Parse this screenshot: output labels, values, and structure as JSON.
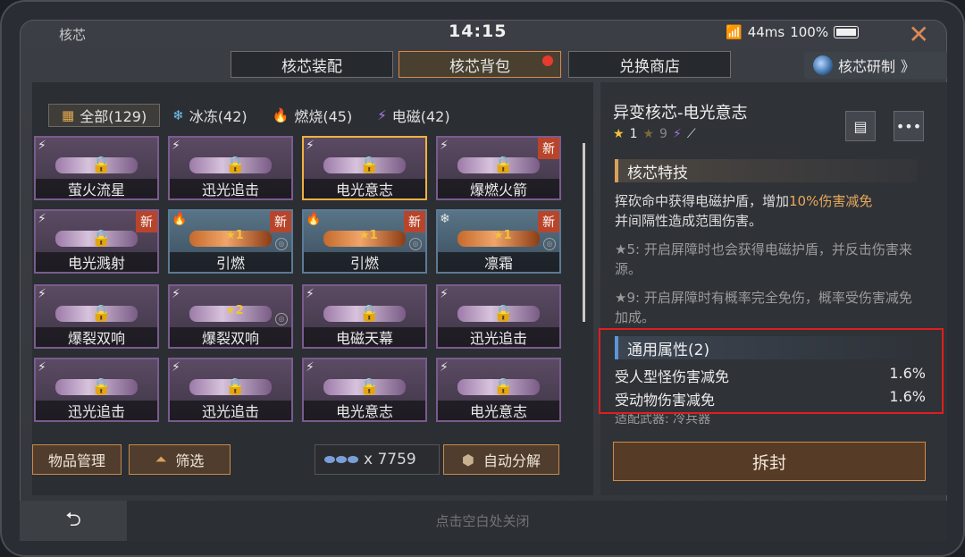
{
  "status": {
    "title": "核芯",
    "clock": "14:15",
    "ping": "44ms",
    "battery": "100%",
    "close": "✕"
  },
  "tabs": [
    {
      "label": "核芯装配"
    },
    {
      "label": "核芯背包"
    },
    {
      "label": "兑换商店"
    }
  ],
  "research": {
    "label": "核芯研制",
    "arrow": "》"
  },
  "filters": [
    {
      "icon": "grid-icon",
      "glyph": "▦",
      "label": "全部(129)"
    },
    {
      "icon": "snowflake-icon",
      "glyph": "❄",
      "label": "冰冻(42)"
    },
    {
      "icon": "flame-icon",
      "glyph": "🔥",
      "label": "燃烧(45)"
    },
    {
      "icon": "lightning-icon",
      "glyph": "⚡",
      "label": "电磁(42)"
    }
  ],
  "cards": [
    {
      "name": "萤火流星",
      "new": ""
    },
    {
      "name": "迅光追击",
      "new": ""
    },
    {
      "name": "电光意志",
      "new": ""
    },
    {
      "name": "爆燃火箭",
      "new": "新"
    },
    {
      "name": "电光溅射",
      "new": "新"
    },
    {
      "name": "引燃",
      "new": "新",
      "star": "1"
    },
    {
      "name": "引燃",
      "new": "新",
      "star": "1"
    },
    {
      "name": "凛霜",
      "new": "新",
      "star": "1"
    },
    {
      "name": "爆裂双响",
      "new": ""
    },
    {
      "name": "爆裂双响",
      "new": "",
      "star": "2"
    },
    {
      "name": "电磁天幕",
      "new": ""
    },
    {
      "name": "迅光追击",
      "new": ""
    },
    {
      "name": "迅光追击",
      "new": ""
    },
    {
      "name": "迅光追击",
      "new": ""
    },
    {
      "name": "电光意志",
      "new": ""
    },
    {
      "name": "电光意志",
      "new": ""
    }
  ],
  "footer": {
    "manage_label": "物品管理",
    "filter_label": "筛选",
    "currency_count": "x 7759",
    "auto_decompose_label": "自动分解",
    "close_hint": "点击空白处关闭",
    "back_glyph": "⮌"
  },
  "detail": {
    "title": "异变核芯-电光意志",
    "star1": "1",
    "star2": "9",
    "skill_header": "核芯特技",
    "skill_desc_a": "挥砍命中获得电磁护盾，增加",
    "skill_desc_hl": "10%伤害减免",
    "skill_desc_b": "并间隔性造成范围伤害。",
    "perk5": "★5: 开启屏障时也会获得电磁护盾，并反击伤害来源。",
    "perk9": "★9: 开启屏障时有概率完全免伤，概率受伤害减免加成。",
    "attr_header": "通用属性(2)",
    "attrs": [
      {
        "name": "受人型怪伤害减免",
        "value": "1.6%"
      },
      {
        "name": "受动物伤害减免",
        "value": "1.6%"
      }
    ],
    "weapon_line": "适配武器: 冷兵器",
    "unseal_label": "拆封"
  }
}
